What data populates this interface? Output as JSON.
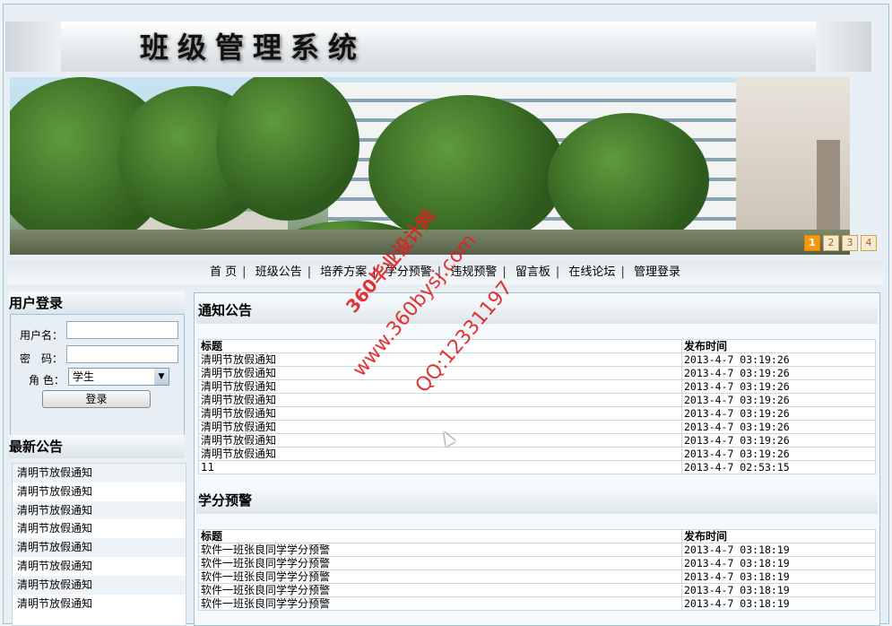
{
  "header": {
    "logo_text": "班级管理系统"
  },
  "banner": {
    "slides": [
      "1",
      "2",
      "3",
      "4"
    ],
    "active_slide": "1"
  },
  "nav": {
    "items": [
      "首 页",
      "班级公告",
      "培养方案",
      "学分预警",
      "违规预警",
      "留言板",
      "在线论坛",
      "管理登录"
    ]
  },
  "login": {
    "title": "用户登录",
    "username_label": "用户名：",
    "password_label": "密　码：",
    "role_label": "角 色：",
    "role_value": "学生",
    "submit_label": "登录"
  },
  "latest": {
    "title": "最新公告",
    "items": [
      "清明节放假通知",
      "清明节放假通知",
      "清明节放假通知",
      "清明节放假通知",
      "清明节放假通知",
      "清明节放假通知",
      "清明节放假通知",
      "清明节放假通知"
    ]
  },
  "notices": {
    "title": "通知公告",
    "col_title": "标题",
    "col_time": "发布时间",
    "rows": [
      {
        "title": "清明节放假通知",
        "time": "2013-4-7 03:19:26"
      },
      {
        "title": "清明节放假通知",
        "time": "2013-4-7 03:19:26"
      },
      {
        "title": "清明节放假通知",
        "time": "2013-4-7 03:19:26"
      },
      {
        "title": "清明节放假通知",
        "time": "2013-4-7 03:19:26"
      },
      {
        "title": "清明节放假通知",
        "time": "2013-4-7 03:19:26"
      },
      {
        "title": "清明节放假通知",
        "time": "2013-4-7 03:19:26"
      },
      {
        "title": "清明节放假通知",
        "time": "2013-4-7 03:19:26"
      },
      {
        "title": "清明节放假通知",
        "time": "2013-4-7 03:19:26"
      },
      {
        "title": "11",
        "time": "2013-4-7 02:53:15"
      }
    ]
  },
  "credit_warning": {
    "title": "学分预警",
    "col_title": "标题",
    "col_time": "发布时间",
    "rows": [
      {
        "title": "软件一班张良同学学分预警",
        "time": "2013-4-7 03:18:19"
      },
      {
        "title": "软件一班张良同学学分预警",
        "time": "2013-4-7 03:18:19"
      },
      {
        "title": "软件一班张良同学学分预警",
        "time": "2013-4-7 03:18:19"
      },
      {
        "title": "软件一班张良同学学分预警",
        "time": "2013-4-7 03:18:19"
      },
      {
        "title": "软件一班张良同学学分预警",
        "time": "2013-4-7 03:18:19"
      }
    ]
  },
  "watermark": {
    "line1": "360毕业设计网",
    "line2": "www.360bysj.com",
    "line3": "QQ:12331197"
  }
}
